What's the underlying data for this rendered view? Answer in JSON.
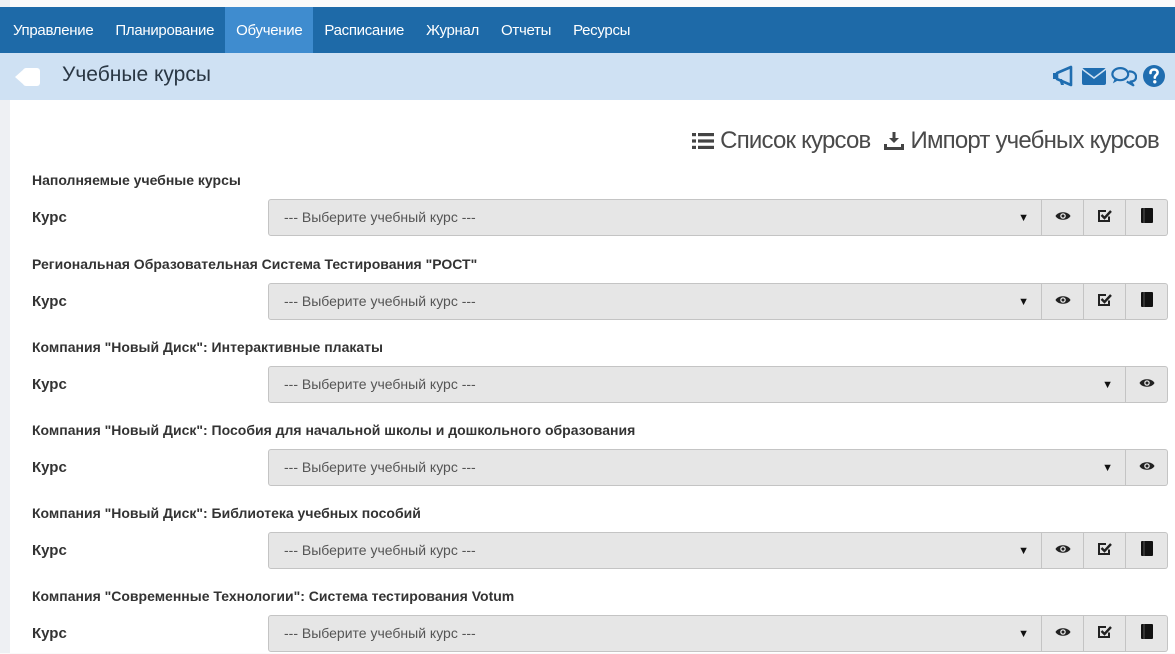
{
  "nav": {
    "items": [
      {
        "label": "Управление",
        "active": false
      },
      {
        "label": "Планирование",
        "active": false
      },
      {
        "label": "Обучение",
        "active": true
      },
      {
        "label": "Расписание",
        "active": false
      },
      {
        "label": "Журнал",
        "active": false
      },
      {
        "label": "Отчеты",
        "active": false
      },
      {
        "label": "Ресурсы",
        "active": false
      }
    ]
  },
  "header": {
    "title": "Учебные курсы",
    "icons": [
      "back-icon",
      "megaphone-icon",
      "envelope-icon",
      "chat-icon",
      "help-icon"
    ]
  },
  "actions": {
    "list_label": "Список курсов",
    "import_label": "Импорт учебных курсов"
  },
  "groups": [
    {
      "title": "Наполняемые учебные курсы",
      "label": "Курс",
      "placeholder": "--- Выберите учебный курс ---",
      "buttons": [
        "view",
        "check",
        "book"
      ]
    },
    {
      "title": "Региональная Образовательная Система Тестирования \"РОСТ\"",
      "label": "Курс",
      "placeholder": "--- Выберите учебный курс ---",
      "buttons": [
        "view",
        "check",
        "book"
      ]
    },
    {
      "title": "Компания \"Новый Диск\": Интерактивные плакаты",
      "label": "Курс",
      "placeholder": "--- Выберите учебный курс ---",
      "buttons": [
        "view"
      ]
    },
    {
      "title": "Компания \"Новый Диск\": Пособия для начальной школы и дошкольного образования",
      "label": "Курс",
      "placeholder": "--- Выберите учебный курс ---",
      "buttons": [
        "view"
      ]
    },
    {
      "title": "Компания \"Новый Диск\": Библиотека учебных пособий",
      "label": "Курс",
      "placeholder": "--- Выберите учебный курс ---",
      "buttons": [
        "view",
        "check",
        "book"
      ]
    },
    {
      "title": "Компания \"Современные Технологии\": Система тестирования Votum",
      "label": "Курс",
      "placeholder": "--- Выберите учебный курс ---",
      "buttons": [
        "view",
        "check",
        "book"
      ]
    }
  ],
  "colors": {
    "nav_bg": "#1e6aa8",
    "nav_active": "#3f8ccf",
    "header_bg": "#cfe1f3",
    "accent_icon": "#1f6db0"
  }
}
